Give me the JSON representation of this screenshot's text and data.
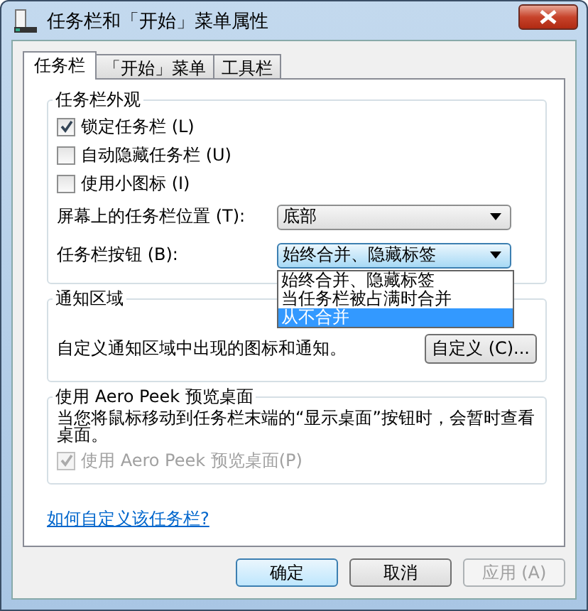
{
  "window": {
    "title": "任务栏和「开始」菜单属性"
  },
  "tabs": [
    {
      "label": "任务栏",
      "selected": true
    },
    {
      "label": "「开始」菜单",
      "selected": false
    },
    {
      "label": "工具栏",
      "selected": false
    }
  ],
  "appearance": {
    "title": "任务栏外观",
    "checkboxes": [
      {
        "label": "锁定任务栏 (L)",
        "checked": true
      },
      {
        "label": "自动隐藏任务栏 (U)",
        "checked": false
      },
      {
        "label": "使用小图标 (I)",
        "checked": false
      }
    ],
    "position": {
      "label": "屏幕上的任务栏位置 (T):",
      "value": "底部"
    },
    "taskbar_buttons": {
      "label": "任务栏按钮 (B):",
      "value": "始终合并、隐藏标签",
      "expanded": true,
      "options": [
        {
          "label": "始终合并、隐藏标签",
          "highlighted": false
        },
        {
          "label": "当任务栏被占满时合并",
          "highlighted": false
        },
        {
          "label": "从不合并",
          "highlighted": true
        }
      ]
    }
  },
  "notification_area": {
    "title": "通知区域",
    "text": "自定义通知区域中出现的图标和通知。",
    "button": "自定义 (C)..."
  },
  "aero_peek": {
    "title": "使用 Aero Peek 预览桌面",
    "text": "当您将鼠标移动到任务栏末端的“显示桌面”按钮时，会暂时查看桌面。",
    "checkbox": {
      "label": "使用 Aero Peek 预览桌面(P)",
      "checked": true,
      "disabled": true
    }
  },
  "help_link": "如何自定义该任务栏?",
  "buttons": [
    {
      "label": "确定",
      "default": true,
      "disabled": false
    },
    {
      "label": "取消",
      "default": false,
      "disabled": false
    },
    {
      "label": "应用 (A)",
      "default": false,
      "disabled": true
    }
  ]
}
